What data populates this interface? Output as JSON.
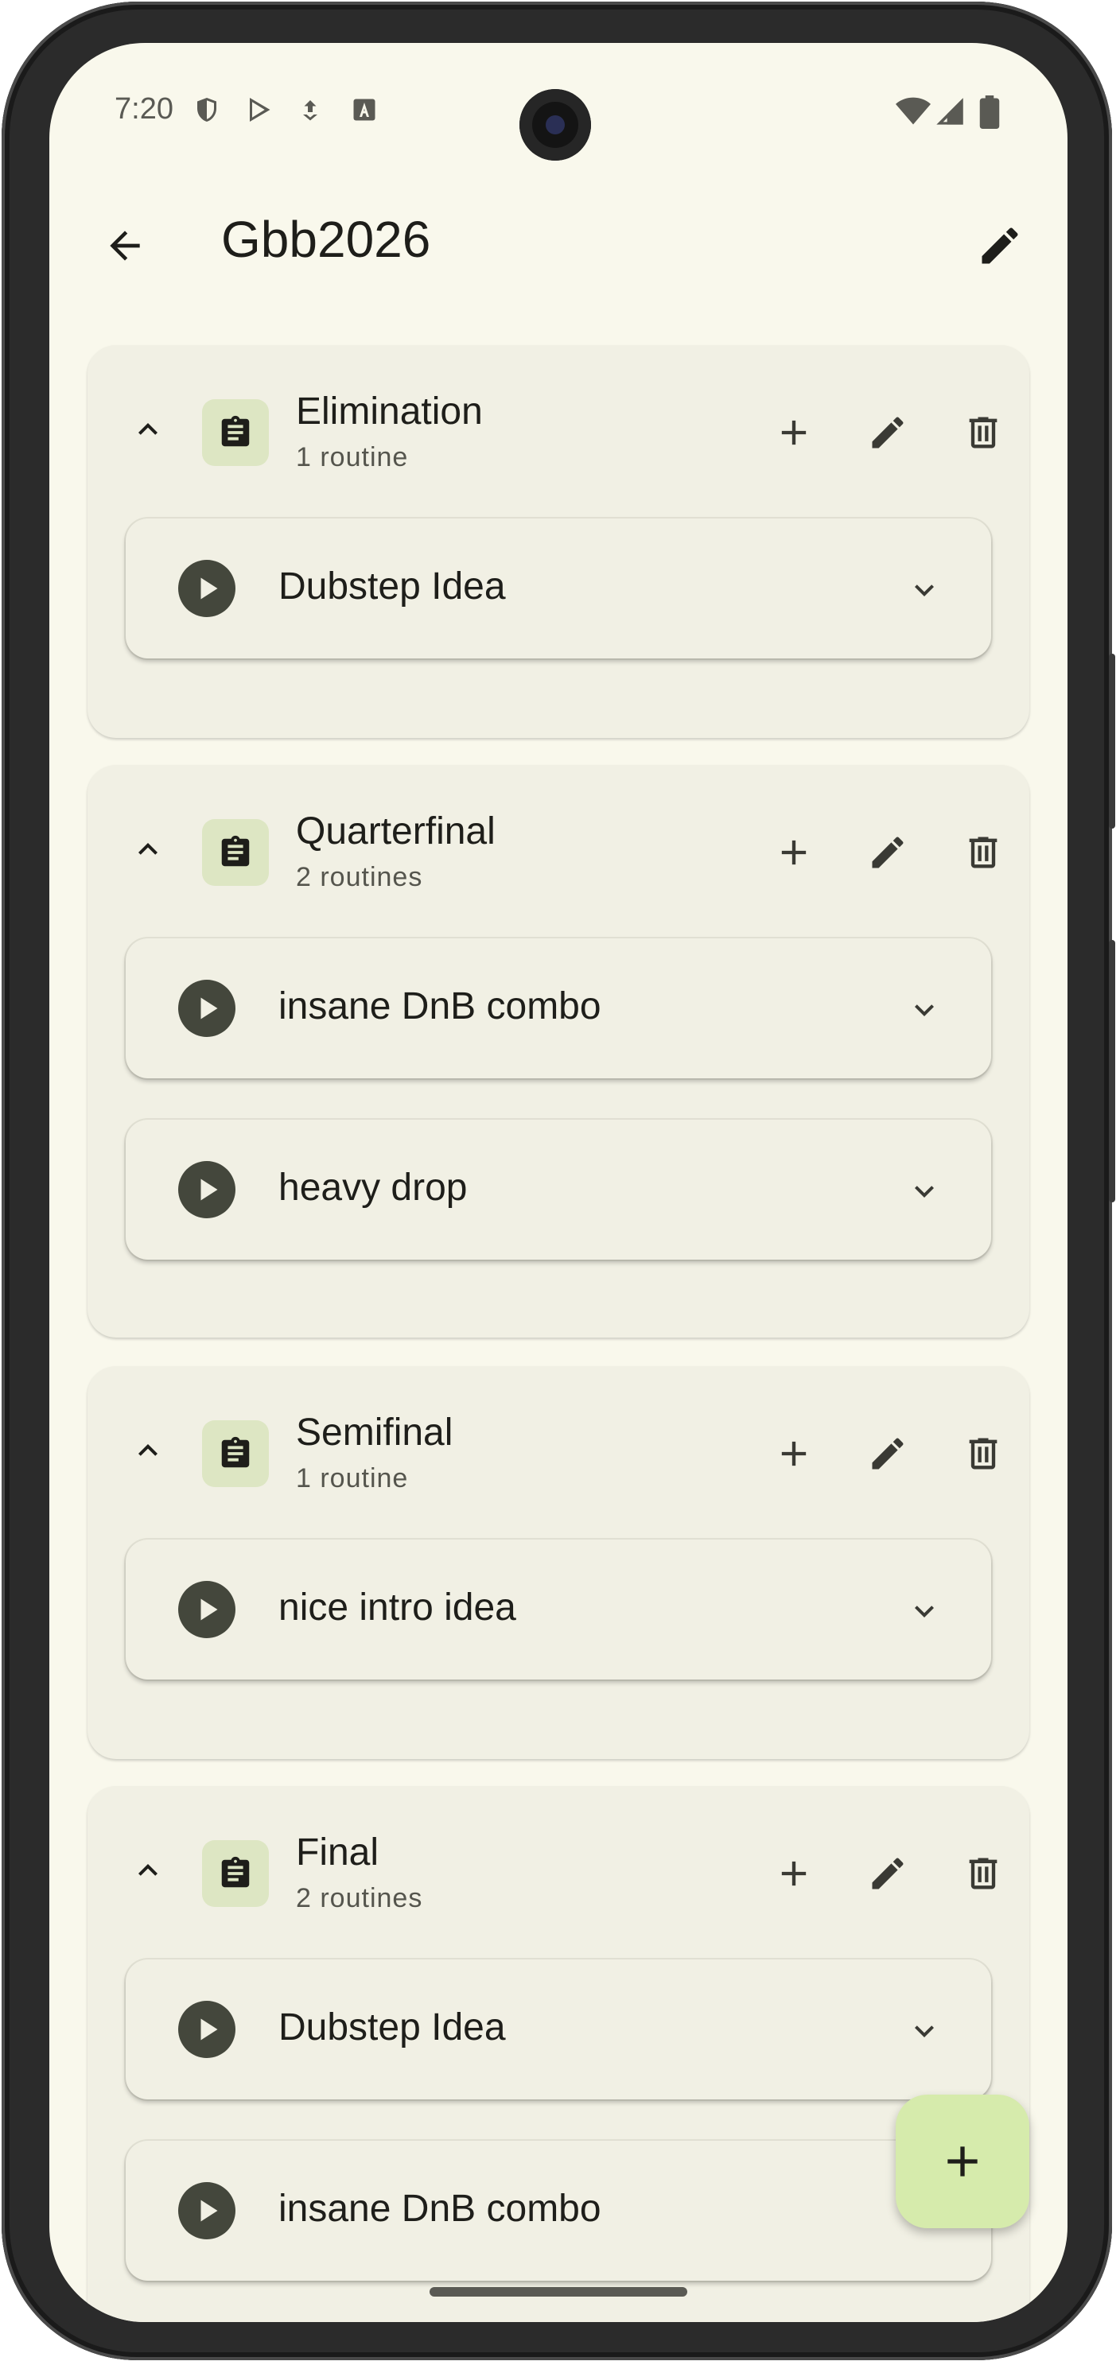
{
  "status_bar": {
    "time": "7:20",
    "left_icons": [
      "shield-icon",
      "play-store-icon",
      "download-icon",
      "font-icon"
    ],
    "right_icons": [
      "wifi-icon",
      "signal-icon",
      "battery-icon"
    ]
  },
  "app_bar": {
    "back_icon": "arrow-back-icon",
    "title": "Gbb2026",
    "edit_icon": "pencil-icon"
  },
  "sections": [
    {
      "title": "Elimination",
      "subtitle": "1 routine",
      "routines": [
        {
          "title": "Dubstep Idea"
        }
      ]
    },
    {
      "title": "Quarterfinal",
      "subtitle": "2 routines",
      "routines": [
        {
          "title": "insane DnB combo"
        },
        {
          "title": "heavy drop"
        }
      ]
    },
    {
      "title": "Semifinal",
      "subtitle": "1 routine",
      "routines": [
        {
          "title": "nice intro idea"
        }
      ]
    },
    {
      "title": "Final",
      "subtitle": "2 routines",
      "routines": [
        {
          "title": "Dubstep Idea"
        },
        {
          "title": "insane DnB combo"
        }
      ]
    }
  ],
  "fab": {
    "icon": "plus-icon"
  },
  "colors": {
    "background": "#f9f8ec",
    "card": "#f1f0e4",
    "badge": "#dde6c3",
    "fab": "#d6ebac",
    "play": "#44473c",
    "text": "#1e1e1a"
  }
}
